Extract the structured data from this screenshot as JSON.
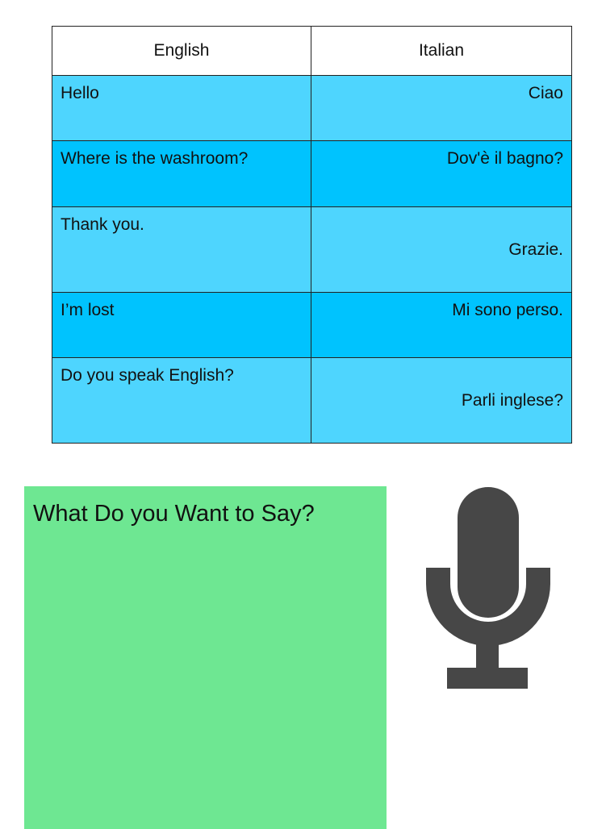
{
  "table": {
    "headers": {
      "english": "English",
      "italian": "Italian"
    },
    "rows": [
      {
        "english": "Hello",
        "italian": "Ciao"
      },
      {
        "english": "Where is the washroom?",
        "italian": "Dov'è il bagno?"
      },
      {
        "english": "Thank you.",
        "italian": "Grazie."
      },
      {
        "english": "I’m lost",
        "italian": "Mi sono perso."
      },
      {
        "english": "Do you speak English?",
        "italian": "Parli inglese?"
      }
    ]
  },
  "say_panel": {
    "prompt": "What Do you Want to Say?"
  },
  "icons": {
    "microphone": "microphone-icon"
  },
  "colors": {
    "row_light": "#4ed5fe",
    "row_dark": "#00c3fe",
    "panel_green": "#6ee792",
    "mic_gray": "#474747"
  }
}
